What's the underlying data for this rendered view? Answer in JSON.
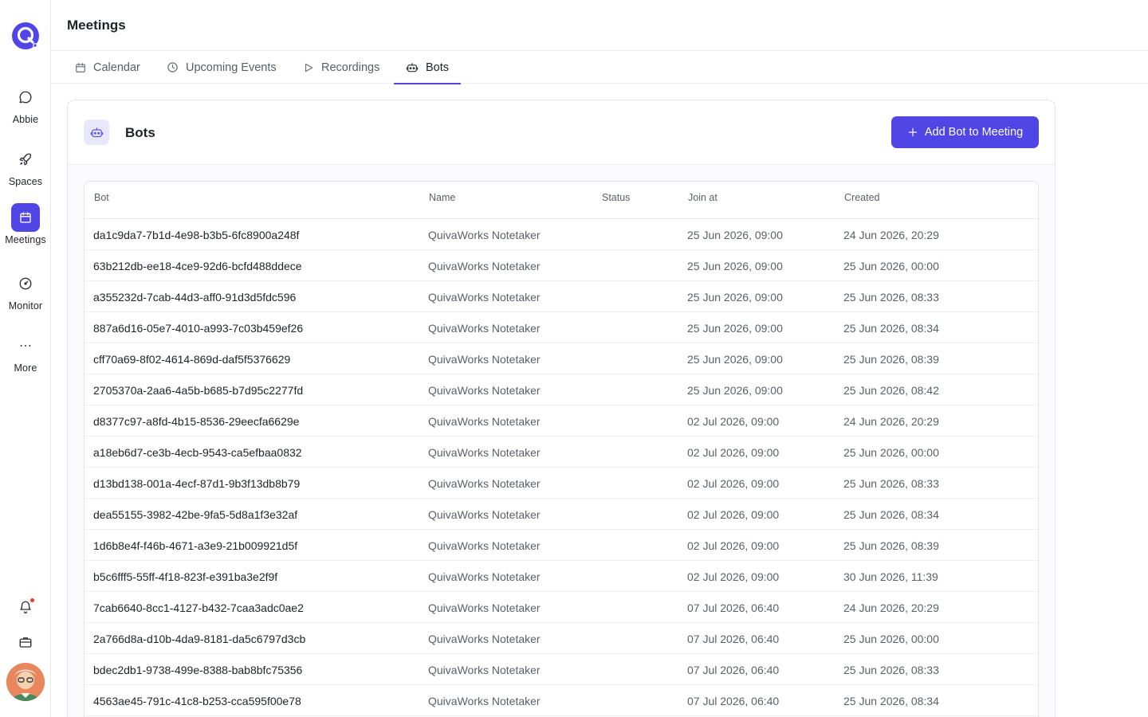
{
  "sidebar": {
    "items": [
      {
        "label": "Abbie",
        "icon": "chat-bubble-icon",
        "active": false
      },
      {
        "label": "Spaces",
        "icon": "rocket-icon",
        "active": false
      },
      {
        "label": "Meetings",
        "icon": "calendar-icon",
        "active": true
      },
      {
        "label": "Monitor",
        "icon": "gauge-icon",
        "active": false
      },
      {
        "label": "More",
        "icon": "ellipsis-icon",
        "active": false
      }
    ]
  },
  "header": {
    "title": "Meetings"
  },
  "tabs": [
    {
      "label": "Calendar",
      "icon": "calendar-icon",
      "active": false
    },
    {
      "label": "Upcoming Events",
      "icon": "clock-icon",
      "active": false
    },
    {
      "label": "Recordings",
      "icon": "play-icon",
      "active": false
    },
    {
      "label": "Bots",
      "icon": "robot-icon",
      "active": true
    }
  ],
  "bots_card": {
    "title": "Bots",
    "add_button_label": "Add Bot to Meeting"
  },
  "table": {
    "columns": {
      "bot": "Bot",
      "name": "Name",
      "status": "Status",
      "join_at": "Join at",
      "created": "Created"
    },
    "rows": [
      {
        "bot": "da1c9da7-7b1d-4e98-b3b5-6fc8900a248f",
        "name": "QuivaWorks Notetaker",
        "status": "",
        "join_at": "25 Jun 2026, 09:00",
        "created": "24 Jun 2026, 20:29"
      },
      {
        "bot": "63b212db-ee18-4ce9-92d6-bcfd488ddece",
        "name": "QuivaWorks Notetaker",
        "status": "",
        "join_at": "25 Jun 2026, 09:00",
        "created": "25 Jun 2026, 00:00"
      },
      {
        "bot": "a355232d-7cab-44d3-aff0-91d3d5fdc596",
        "name": "QuivaWorks Notetaker",
        "status": "",
        "join_at": "25 Jun 2026, 09:00",
        "created": "25 Jun 2026, 08:33"
      },
      {
        "bot": "887a6d16-05e7-4010-a993-7c03b459ef26",
        "name": "QuivaWorks Notetaker",
        "status": "",
        "join_at": "25 Jun 2026, 09:00",
        "created": "25 Jun 2026, 08:34"
      },
      {
        "bot": "cff70a69-8f02-4614-869d-daf5f5376629",
        "name": "QuivaWorks Notetaker",
        "status": "",
        "join_at": "25 Jun 2026, 09:00",
        "created": "25 Jun 2026, 08:39"
      },
      {
        "bot": "2705370a-2aa6-4a5b-b685-b7d95c2277fd",
        "name": "QuivaWorks Notetaker",
        "status": "",
        "join_at": "25 Jun 2026, 09:00",
        "created": "25 Jun 2026, 08:42"
      },
      {
        "bot": "d8377c97-a8fd-4b15-8536-29eecfa6629e",
        "name": "QuivaWorks Notetaker",
        "status": "",
        "join_at": "02 Jul 2026, 09:00",
        "created": "24 Jun 2026, 20:29"
      },
      {
        "bot": "a18eb6d7-ce3b-4ecb-9543-ca5efbaa0832",
        "name": "QuivaWorks Notetaker",
        "status": "",
        "join_at": "02 Jul 2026, 09:00",
        "created": "25 Jun 2026, 00:00"
      },
      {
        "bot": "d13bd138-001a-4ecf-87d1-9b3f13db8b79",
        "name": "QuivaWorks Notetaker",
        "status": "",
        "join_at": "02 Jul 2026, 09:00",
        "created": "25 Jun 2026, 08:33"
      },
      {
        "bot": "dea55155-3982-42be-9fa5-5d8a1f3e32af",
        "name": "QuivaWorks Notetaker",
        "status": "",
        "join_at": "02 Jul 2026, 09:00",
        "created": "25 Jun 2026, 08:34"
      },
      {
        "bot": "1d6b8e4f-f46b-4671-a3e9-21b009921d5f",
        "name": "QuivaWorks Notetaker",
        "status": "",
        "join_at": "02 Jul 2026, 09:00",
        "created": "25 Jun 2026, 08:39"
      },
      {
        "bot": "b5c6fff5-55ff-4f18-823f-e391ba3e2f9f",
        "name": "QuivaWorks Notetaker",
        "status": "",
        "join_at": "02 Jul 2026, 09:00",
        "created": "30 Jun 2026, 11:39"
      },
      {
        "bot": "7cab6640-8cc1-4127-b432-7caa3adc0ae2",
        "name": "QuivaWorks Notetaker",
        "status": "",
        "join_at": "07 Jul 2026, 06:40",
        "created": "24 Jun 2026, 20:29"
      },
      {
        "bot": "2a766d8a-d10b-4da9-8181-da5c6797d3cb",
        "name": "QuivaWorks Notetaker",
        "status": "",
        "join_at": "07 Jul 2026, 06:40",
        "created": "25 Jun 2026, 00:00"
      },
      {
        "bot": "bdec2db1-9738-499e-8388-bab8bfc75356",
        "name": "QuivaWorks Notetaker",
        "status": "",
        "join_at": "07 Jul 2026, 06:40",
        "created": "25 Jun 2026, 08:33"
      },
      {
        "bot": "4563ae45-791c-41c8-b253-cca595f00e78",
        "name": "QuivaWorks Notetaker",
        "status": "",
        "join_at": "07 Jul 2026, 06:40",
        "created": "25 Jun 2026, 08:34"
      }
    ]
  },
  "bottom_icons": {
    "notifications": "bell-icon",
    "workspace": "briefcase-icon",
    "avatar": "user-avatar"
  },
  "colors": {
    "accent": "#4f46e5",
    "notification_dot": "#e53935",
    "card_icon_bg": "#e9e8fb"
  }
}
